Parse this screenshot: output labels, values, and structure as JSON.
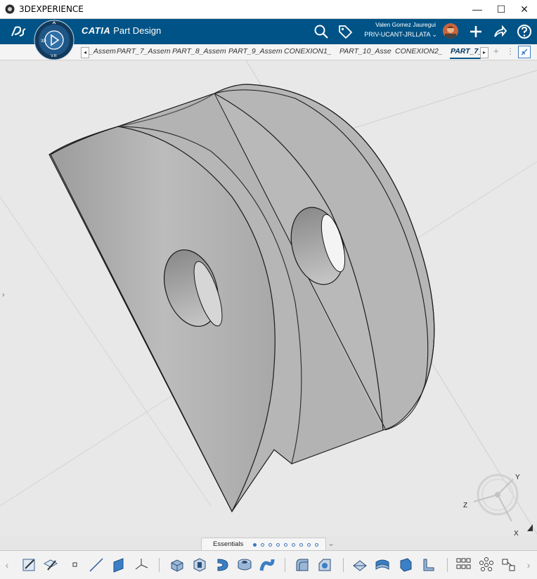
{
  "window": {
    "title": "3DEXPERIENCE",
    "minimize": "—",
    "maximize": "☐",
    "close": "✕"
  },
  "topbar": {
    "app_brand": "CATIA",
    "app_name": "Part Design",
    "user_name": "Valen Gomez Jauregui",
    "user_context": "PRIV-UCANT-JRLLATA",
    "compass_label": "V.R",
    "compass_3d": "3D"
  },
  "tabs": {
    "items": [
      "_Assem",
      "PART_7_Assem",
      "PART_8_Assem",
      "PART_9_Assem",
      "CONEXION1_",
      "PART_10_Asse",
      "CONEXION2_",
      "PART_7_"
    ],
    "active_index": 7,
    "prev": "◂",
    "next": "▸",
    "add": "+",
    "more": "⋮"
  },
  "compass": {
    "x": "X",
    "y": "Y",
    "z": "Z"
  },
  "essentials": {
    "label": "Essentials",
    "pages": 9,
    "active_page": 0
  },
  "colors": {
    "topbar": "#005386",
    "accent": "#3a78c2",
    "part": "#b4b4b4"
  },
  "toolbar": {
    "icons": [
      "sketch-icon",
      "positioned-sketch-icon",
      "point-icon",
      "line-icon",
      "plane-icon",
      "axis-system-icon",
      "pad-icon",
      "pocket-icon",
      "shaft-icon",
      "hole-icon",
      "rib-icon",
      "fillet-icon",
      "chamfer-icon",
      "split-icon",
      "thick-surface-icon",
      "close-surface-icon",
      "sew-surface-icon",
      "pattern-icon",
      "circular-pattern-icon",
      "transformation-icon"
    ]
  }
}
